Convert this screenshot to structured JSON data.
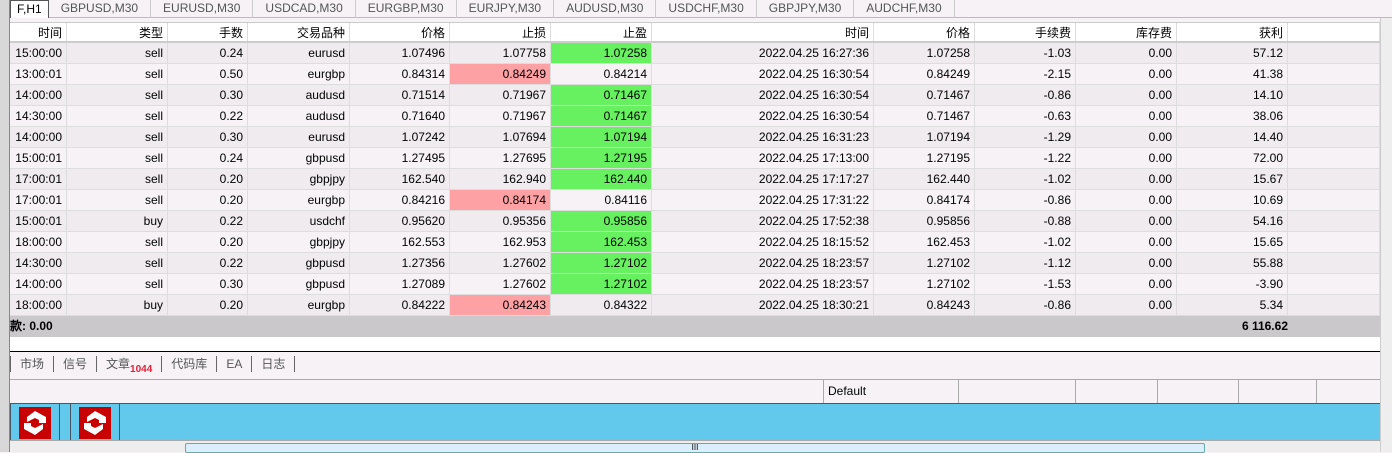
{
  "chart_tabs": [
    "F,H1",
    "GBPUSD,M30",
    "EURUSD,M30",
    "USDCAD,M30",
    "EURGBP,M30",
    "EURJPY,M30",
    "AUDUSD,M30",
    "USDCHF,M30",
    "GBPJPY,M30",
    "AUDCHF,M30"
  ],
  "columns": [
    "时间",
    "类型",
    "手数",
    "交易品种",
    "价格",
    "止损",
    "止盈",
    "时间",
    "价格",
    "手续费",
    "库存费",
    "获利"
  ],
  "sort_indicator": "/",
  "rows": [
    [
      "15:00:00",
      "sell",
      "0.24",
      "eurusd",
      "1.07496",
      "1.07758",
      "1.07258",
      "2022.04.25 16:27:36",
      "1.07258",
      "-1.03",
      "0.00",
      "57.12",
      "tp"
    ],
    [
      "13:00:01",
      "sell",
      "0.50",
      "eurgbp",
      "0.84314",
      "0.84249",
      "0.84214",
      "2022.04.25 16:30:54",
      "0.84249",
      "-2.15",
      "0.00",
      "41.38",
      "sl"
    ],
    [
      "14:00:00",
      "sell",
      "0.30",
      "audusd",
      "0.71514",
      "0.71967",
      "0.71467",
      "2022.04.25 16:30:54",
      "0.71467",
      "-0.86",
      "0.00",
      "14.10",
      "tp"
    ],
    [
      "14:30:00",
      "sell",
      "0.22",
      "audusd",
      "0.71640",
      "0.71967",
      "0.71467",
      "2022.04.25 16:30:54",
      "0.71467",
      "-0.63",
      "0.00",
      "38.06",
      "tp"
    ],
    [
      "14:00:00",
      "sell",
      "0.30",
      "eurusd",
      "1.07242",
      "1.07694",
      "1.07194",
      "2022.04.25 16:31:23",
      "1.07194",
      "-1.29",
      "0.00",
      "14.40",
      "tp"
    ],
    [
      "15:00:01",
      "sell",
      "0.24",
      "gbpusd",
      "1.27495",
      "1.27695",
      "1.27195",
      "2022.04.25 17:13:00",
      "1.27195",
      "-1.22",
      "0.00",
      "72.00",
      "tp"
    ],
    [
      "17:00:01",
      "sell",
      "0.20",
      "gbpjpy",
      "162.540",
      "162.940",
      "162.440",
      "2022.04.25 17:17:27",
      "162.440",
      "-1.02",
      "0.00",
      "15.67",
      "tp"
    ],
    [
      "17:00:01",
      "sell",
      "0.20",
      "eurgbp",
      "0.84216",
      "0.84174",
      "0.84116",
      "2022.04.25 17:31:22",
      "0.84174",
      "-0.86",
      "0.00",
      "10.69",
      "sl"
    ],
    [
      "15:00:01",
      "buy",
      "0.22",
      "usdchf",
      "0.95620",
      "0.95356",
      "0.95856",
      "2022.04.25 17:52:38",
      "0.95856",
      "-0.88",
      "0.00",
      "54.16",
      "tp"
    ],
    [
      "18:00:00",
      "sell",
      "0.20",
      "gbpjpy",
      "162.553",
      "162.953",
      "162.453",
      "2022.04.25 18:15:52",
      "162.453",
      "-1.02",
      "0.00",
      "15.65",
      "tp"
    ],
    [
      "14:30:00",
      "sell",
      "0.22",
      "gbpusd",
      "1.27356",
      "1.27602",
      "1.27102",
      "2022.04.25 18:23:57",
      "1.27102",
      "-1.12",
      "0.00",
      "55.88",
      "tp"
    ],
    [
      "14:00:00",
      "sell",
      "0.30",
      "gbpusd",
      "1.27089",
      "1.27602",
      "1.27102",
      "2022.04.25 18:23:57",
      "1.27102",
      "-1.53",
      "0.00",
      "-3.90",
      "tp"
    ],
    [
      "18:00:00",
      "buy",
      "0.20",
      "eurgbp",
      "0.84222",
      "0.84243",
      "0.84322",
      "2022.04.25 18:30:21",
      "0.84243",
      "-0.86",
      "0.00",
      "5.34",
      "sl"
    ]
  ],
  "summary": {
    "left": "款: 0.00",
    "profit": "6 116.62"
  },
  "bottom_tabs": [
    {
      "label": "市场"
    },
    {
      "label": "信号"
    },
    {
      "label": "文章",
      "badge": "1044"
    },
    {
      "label": "代码库"
    },
    {
      "label": "EA"
    },
    {
      "label": "日志"
    }
  ],
  "status": {
    "profile": "Default"
  },
  "colors": {
    "sl_hit": "#fda1a5",
    "tp_hit": "#67f05f",
    "taskbar": "#62c9ed"
  }
}
